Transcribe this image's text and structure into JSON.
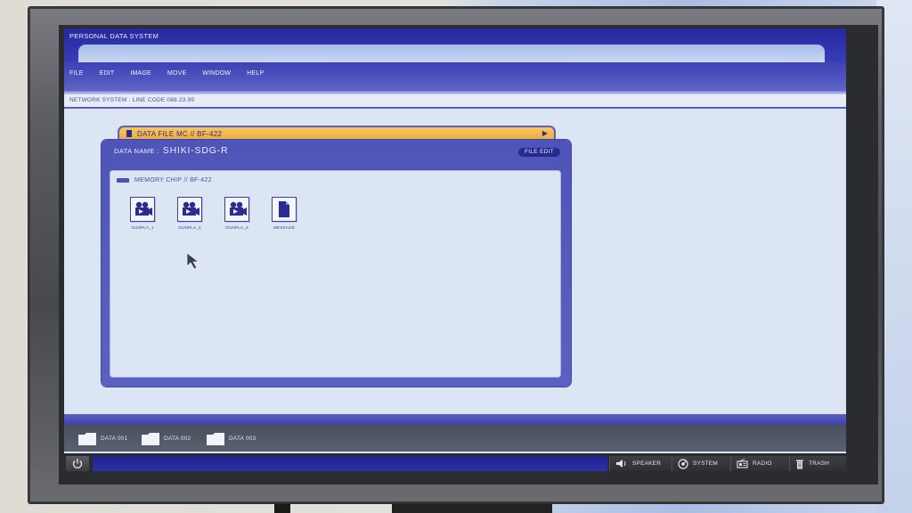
{
  "window": {
    "title": "PERSONAL DATA SYSTEM"
  },
  "menu": [
    "FILE",
    "EDIT",
    "IMAGE",
    "MOVE",
    "WINDOW",
    "HELP"
  ],
  "status": {
    "network": "NETWORK SYSTEM : LINE CODE 088.23.99"
  },
  "data_file": {
    "tab_label": "DATA FILE  MC // BF-422",
    "name_label": "DATA NAME :",
    "name_value": "SHIKI-SDG-R",
    "file_edit_button": "FILE EDIT",
    "memory_chip_label": "MEMORY CHIP // BF-422",
    "files": [
      {
        "label": "GUNPLA_1",
        "icon": "video-camera-icon"
      },
      {
        "label": "GUNPLA_2",
        "icon": "video-camera-icon"
      },
      {
        "label": "GUNPLA_3",
        "icon": "video-camera-icon"
      },
      {
        "label": "MESSAGE",
        "icon": "document-icon"
      }
    ]
  },
  "folders": [
    {
      "label": "DATA 001",
      "icon": "folder-icon"
    },
    {
      "label": "DATA 002",
      "icon": "folder-icon"
    },
    {
      "label": "DATA 003",
      "icon": "folder-icon"
    }
  ],
  "taskbar": {
    "tray": [
      {
        "label": "SPEAKER",
        "icon": "speaker-icon"
      },
      {
        "label": "SYSTEM",
        "icon": "system-icon"
      },
      {
        "label": "RADIO",
        "icon": "radio-icon"
      },
      {
        "label": "TRASH",
        "icon": "trash-icon"
      }
    ]
  },
  "colors": {
    "accent": "#3135b0",
    "tab": "#eba83b",
    "screen_bg": "#dbe5f3"
  }
}
